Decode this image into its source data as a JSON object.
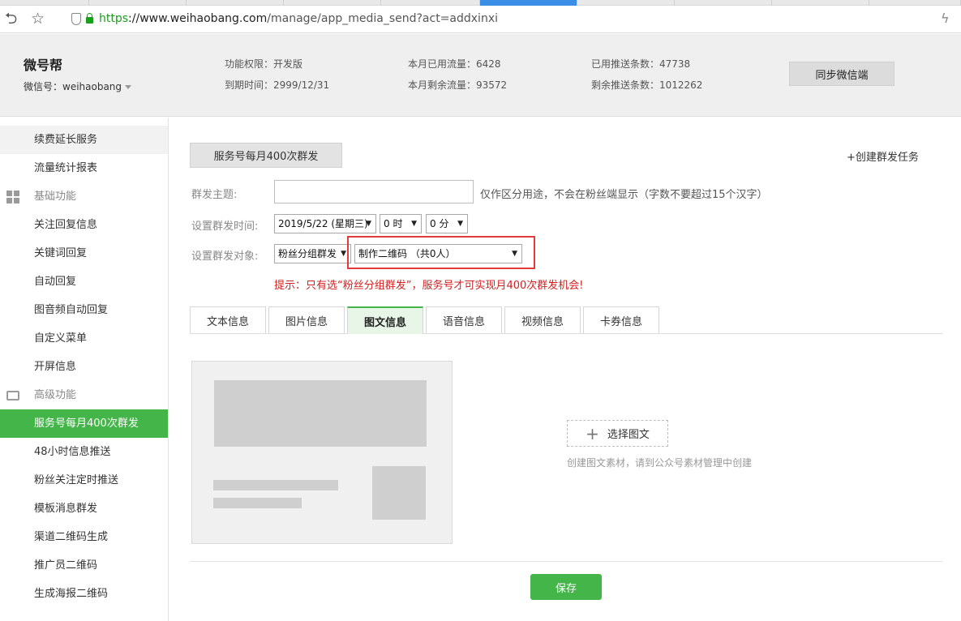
{
  "browser": {
    "url_scheme": "https",
    "url_host": "://www.weihaobang.com",
    "url_path": "/manage/app_media_send?act=addxinxi"
  },
  "header": {
    "brand": "微号帮",
    "wechat_id_label": "微信号：weihaobang",
    "feature_perm": "功能权限：开发版",
    "expire_time": "到期时间：2999/12/31",
    "traffic_used": "本月已用流量：6428",
    "traffic_left": "本月剩余流量：93572",
    "push_used": "已用推送条数：47738",
    "push_left": "剩余推送条数：1012262",
    "sync_button": "同步微信端"
  },
  "sidebar": {
    "items": [
      {
        "label": "续费延长服务",
        "type": "item",
        "state": "hover"
      },
      {
        "label": "流量统计报表",
        "type": "item"
      },
      {
        "label": "基础功能",
        "type": "group",
        "icon": "grid-icon"
      },
      {
        "label": "关注回复信息",
        "type": "item"
      },
      {
        "label": "关键词回复",
        "type": "item"
      },
      {
        "label": "自动回复",
        "type": "item"
      },
      {
        "label": "图音频自动回复",
        "type": "item"
      },
      {
        "label": "自定义菜单",
        "type": "item"
      },
      {
        "label": "开屏信息",
        "type": "item"
      },
      {
        "label": "高级功能",
        "type": "group",
        "icon": "inbox-icon"
      },
      {
        "label": "服务号每月400次群发",
        "type": "item",
        "state": "active"
      },
      {
        "label": "48小时信息推送",
        "type": "item"
      },
      {
        "label": "粉丝关注定时推送",
        "type": "item"
      },
      {
        "label": "模板消息群发",
        "type": "item"
      },
      {
        "label": "渠道二维码生成",
        "type": "item"
      },
      {
        "label": "推广员二维码",
        "type": "item"
      },
      {
        "label": "生成海报二维码",
        "type": "item"
      }
    ]
  },
  "main": {
    "title_button": "服务号每月400次群发",
    "create_link": "+创建群发任务",
    "subject_label": "群发主题:",
    "subject_value": "",
    "subject_hint": "仅作区分用途，不会在粉丝端显示（字数不要超过15个汉字）",
    "time_label": "设置群发时间:",
    "date_select": "2019/5/22 (星期三)",
    "hour_select": "0 时",
    "minute_select": "0 分",
    "target_label": "设置群发对象:",
    "target_type_select": "粉丝分组群发",
    "target_group_select": "制作二维码 （共0人）",
    "warning": "提示：只有选“粉丝分组群发”，服务号才可实现月400次群发机会!",
    "tabs": [
      "文本信息",
      "图片信息",
      "图文信息",
      "语音信息",
      "视频信息",
      "卡券信息"
    ],
    "active_tab": "图文信息",
    "pick_button": "选择图文",
    "pick_hint": "创建图文素材，请到公众号素材管理中创建",
    "save_button": "保存"
  },
  "colors": {
    "accent": "#44b549",
    "warning": "#d42020",
    "highlight_border": "#e23b3b"
  }
}
